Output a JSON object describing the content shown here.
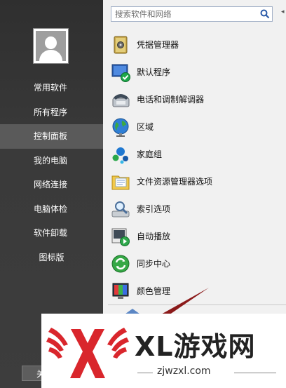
{
  "sidebar": {
    "items": [
      {
        "label": "常用软件"
      },
      {
        "label": "所有程序"
      },
      {
        "label": "控制面板"
      },
      {
        "label": "我的电脑"
      },
      {
        "label": "网络连接"
      },
      {
        "label": "电脑体检"
      },
      {
        "label": "软件卸载"
      },
      {
        "label": "图标版"
      }
    ],
    "active": "控制面板",
    "shutdown_label": "关"
  },
  "search": {
    "placeholder": "搜索软件和网络",
    "icon": "search-icon"
  },
  "control_panel": {
    "items": [
      {
        "label": "凭据管理器",
        "icon": "credential-manager-icon"
      },
      {
        "label": "默认程序",
        "icon": "default-programs-icon"
      },
      {
        "label": "电话和调制解调器",
        "icon": "phone-modem-icon"
      },
      {
        "label": "区域",
        "icon": "region-globe-icon"
      },
      {
        "label": "家庭组",
        "icon": "homegroup-icon"
      },
      {
        "label": "文件资源管理器选项",
        "icon": "folder-options-icon"
      },
      {
        "label": "索引选项",
        "icon": "indexing-options-icon"
      },
      {
        "label": "自动播放",
        "icon": "autoplay-icon"
      },
      {
        "label": "同步中心",
        "icon": "sync-center-icon"
      },
      {
        "label": "颜色管理",
        "icon": "color-management-icon"
      }
    ]
  },
  "watermark": {
    "title": "XL游戏网",
    "url": "zjwzxl.com"
  },
  "colors": {
    "sidebar_bg": "#3a3a3a",
    "active_bg": "#5a5a5a",
    "watermark_red": "#d9262c",
    "arrow": "#8b1a1a"
  }
}
